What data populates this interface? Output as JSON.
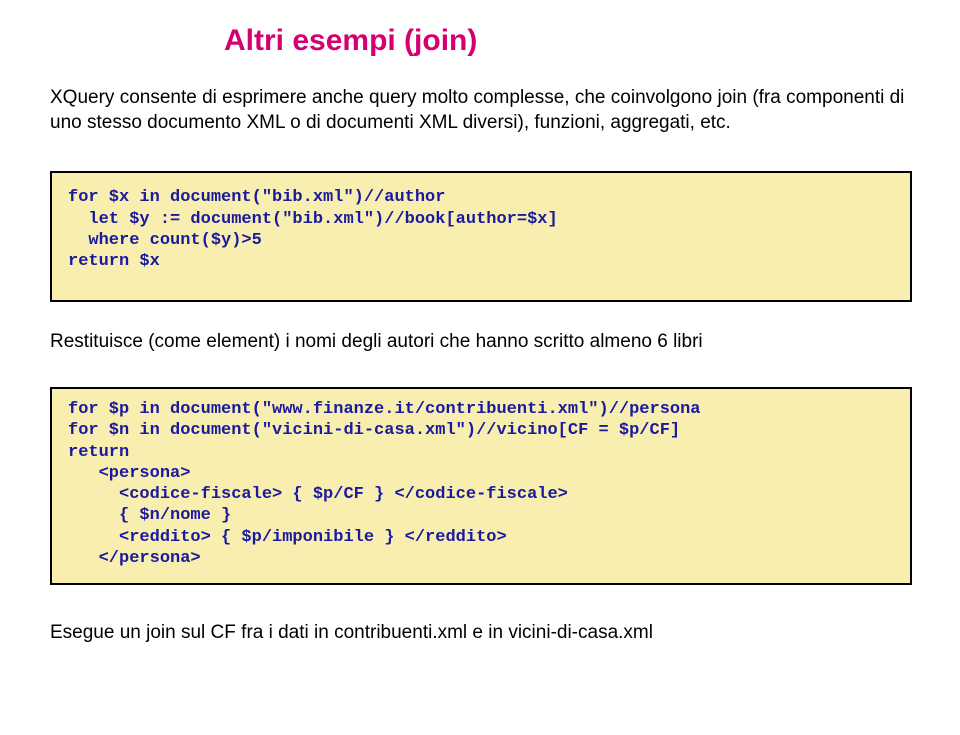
{
  "title": "Altri esempi (join)",
  "intro": "XQuery consente di esprimere anche query molto complesse, che coinvolgono join (fra componenti di uno stesso documento XML o di documenti XML diversi), funzioni, aggregati, etc.",
  "code1": "for $x in document(\"bib.xml\")//author\n  let $y := document(\"bib.xml\")//book[author=$x]\n  where count($y)>5\nreturn $x",
  "mid": "Restituisce (come element) i nomi degli autori che hanno scritto almeno 6 libri",
  "code2": "for $p in document(\"www.finanze.it/contribuenti.xml\")//persona\nfor $n in document(\"vicini-di-casa.xml\")//vicino[CF = $p/CF]\nreturn\n   <persona>\n     <codice-fiscale> { $p/CF } </codice-fiscale>\n     { $n/nome }\n     <reddito> { $p/imponibile } </reddito>\n   </persona>",
  "outro": "Esegue un join sul CF fra i dati in contribuenti.xml e in vicini-di-casa.xml"
}
